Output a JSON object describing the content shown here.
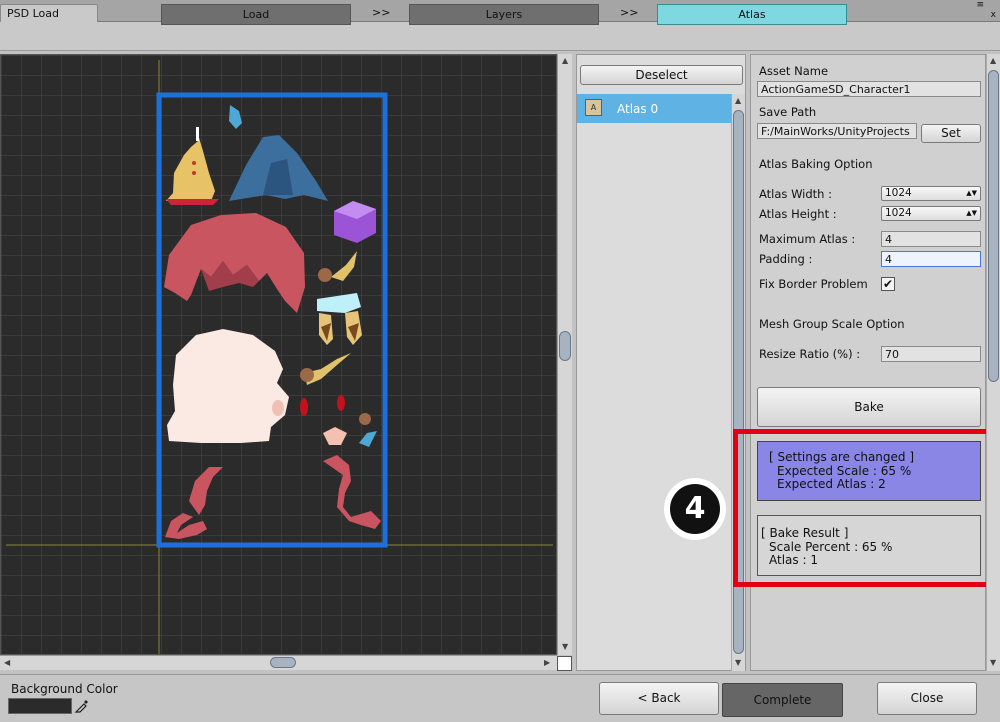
{
  "window": {
    "tab_title": "PSD Load",
    "menu_glyph": "≡",
    "close_glyph": "x"
  },
  "steps": {
    "load": "Load",
    "sep1": ">>",
    "layers": "Layers",
    "sep2": ">>",
    "atlas": "Atlas",
    "active_color": "#7ed8e0"
  },
  "layer_list": {
    "deselect_label": "Deselect",
    "items": [
      {
        "label": "Atlas 0",
        "icon": "atlas-image-icon",
        "selected": true
      }
    ]
  },
  "settings": {
    "asset_name_label": "Asset Name",
    "asset_name_value": "ActionGameSD_Character1",
    "save_path_label": "Save Path",
    "save_path_value": "F:/MainWorks/UnityProjects",
    "set_label": "Set",
    "baking_option_title": "Atlas Baking Option",
    "atlas_width_label": "Atlas Width :",
    "atlas_width_value": "1024",
    "atlas_height_label": "Atlas Height :",
    "atlas_height_value": "1024",
    "max_atlas_label": "Maximum Atlas :",
    "max_atlas_value": "4",
    "padding_label": "Padding :",
    "padding_value": "4",
    "fix_border_label": "Fix Border Problem",
    "fix_border_checked": true,
    "check_glyph": "✔",
    "mesh_group_title": "Mesh Group Scale Option",
    "resize_ratio_label": "Resize Ratio (%) :",
    "resize_ratio_value": "70",
    "bake_label": "Bake"
  },
  "status": {
    "changed_title": "[ Settings are changed ]",
    "expected_scale": "Expected Scale : 65 %",
    "expected_atlas": "Expected Atlas : 2",
    "result_title": "[ Bake Result ]",
    "scale_percent": "Scale Percent : 65 %",
    "atlas_count": "Atlas : 1",
    "changed_color": "#8a86e6",
    "highlight_color": "#e40014"
  },
  "annotation": {
    "step_number": "4"
  },
  "bottom": {
    "bg_color_label": "Background Color",
    "bg_color_value": "#2b2b2b",
    "back_label": "< Back",
    "complete_label": "Complete",
    "close_label": "Close"
  },
  "canvas": {
    "atlas_border_color": "#1e6fd9",
    "background": "#2b2b2b"
  }
}
